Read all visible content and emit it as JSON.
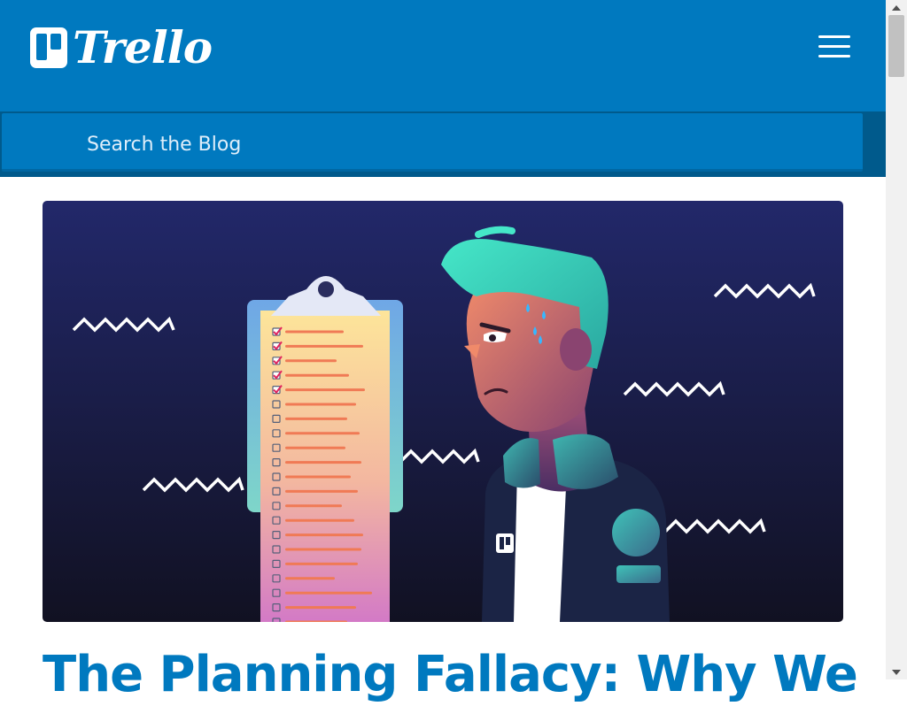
{
  "header": {
    "logo_text": "Trello",
    "logo_icon": "trello-board-icon",
    "menu_icon": "hamburger-menu-icon",
    "bg_color": "#0079bf"
  },
  "search": {
    "placeholder": "Search the Blog"
  },
  "article": {
    "hero_image": {
      "icons": [
        "clipboard-checklist-icon",
        "worried-man-illustration",
        "zigzag-decoration-icon"
      ],
      "checklist_checked": 5,
      "checklist_total": 21
    },
    "title": "The Planning Fallacy: Why We"
  },
  "colors": {
    "brand": "#0079bf",
    "hero_bg_top": "#22286a",
    "hero_bg_bottom": "#111122",
    "title": "#0079bf"
  }
}
